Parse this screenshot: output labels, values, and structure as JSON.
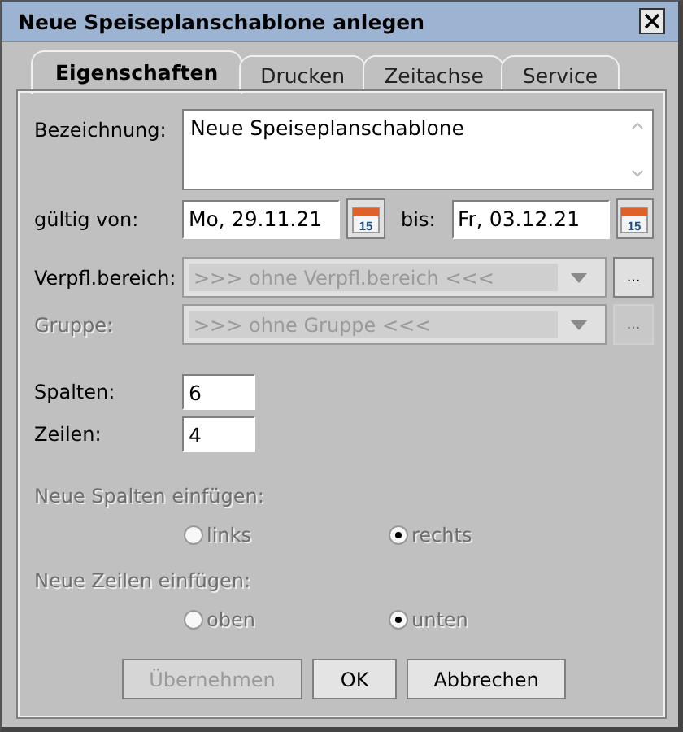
{
  "window": {
    "title": "Neue Speiseplanschablone anlegen"
  },
  "tabs": [
    {
      "label": "Eigenschaften",
      "selected": true
    },
    {
      "label": "Drucken",
      "selected": false
    },
    {
      "label": "Zeitachse",
      "selected": false
    },
    {
      "label": "Service",
      "selected": false
    }
  ],
  "bezeichnung": {
    "label": "Bezeichnung:",
    "value": "Neue Speiseplanschablone"
  },
  "validity": {
    "label": "gültig von:",
    "from": "Mo, 29.11.21",
    "to_label": "bis:",
    "to": "Fr, 03.12.21",
    "from_calendar_day": "15",
    "to_calendar_day": "15"
  },
  "selects": [
    {
      "label": "Verpfl.bereich:",
      "value": ">>> ohne Verpfl.bereich <<<",
      "disabled": true,
      "button": "...",
      "button_disabled": false
    },
    {
      "label": "Gruppe:",
      "value": ">>> ohne Gruppe <<<",
      "disabled": true,
      "button": "...",
      "button_disabled": true,
      "label_disabled": true
    }
  ],
  "numbers": [
    {
      "label": "Spalten:",
      "value": "6"
    },
    {
      "label": "Zeilen:",
      "value": "4"
    }
  ],
  "radio_groups": [
    {
      "label": "Neue Spalten einfügen:",
      "disabled": true,
      "options": [
        {
          "label": "links",
          "selected": false
        },
        {
          "label": "rechts",
          "selected": true
        }
      ]
    },
    {
      "label": "Neue Zeilen einfügen:",
      "disabled": true,
      "options": [
        {
          "label": "oben",
          "selected": false
        },
        {
          "label": "unten",
          "selected": true
        }
      ]
    }
  ],
  "buttons": [
    {
      "label": "Übernehmen",
      "disabled": true
    },
    {
      "label": "OK",
      "disabled": false
    },
    {
      "label": "Abbrechen",
      "disabled": false
    }
  ]
}
